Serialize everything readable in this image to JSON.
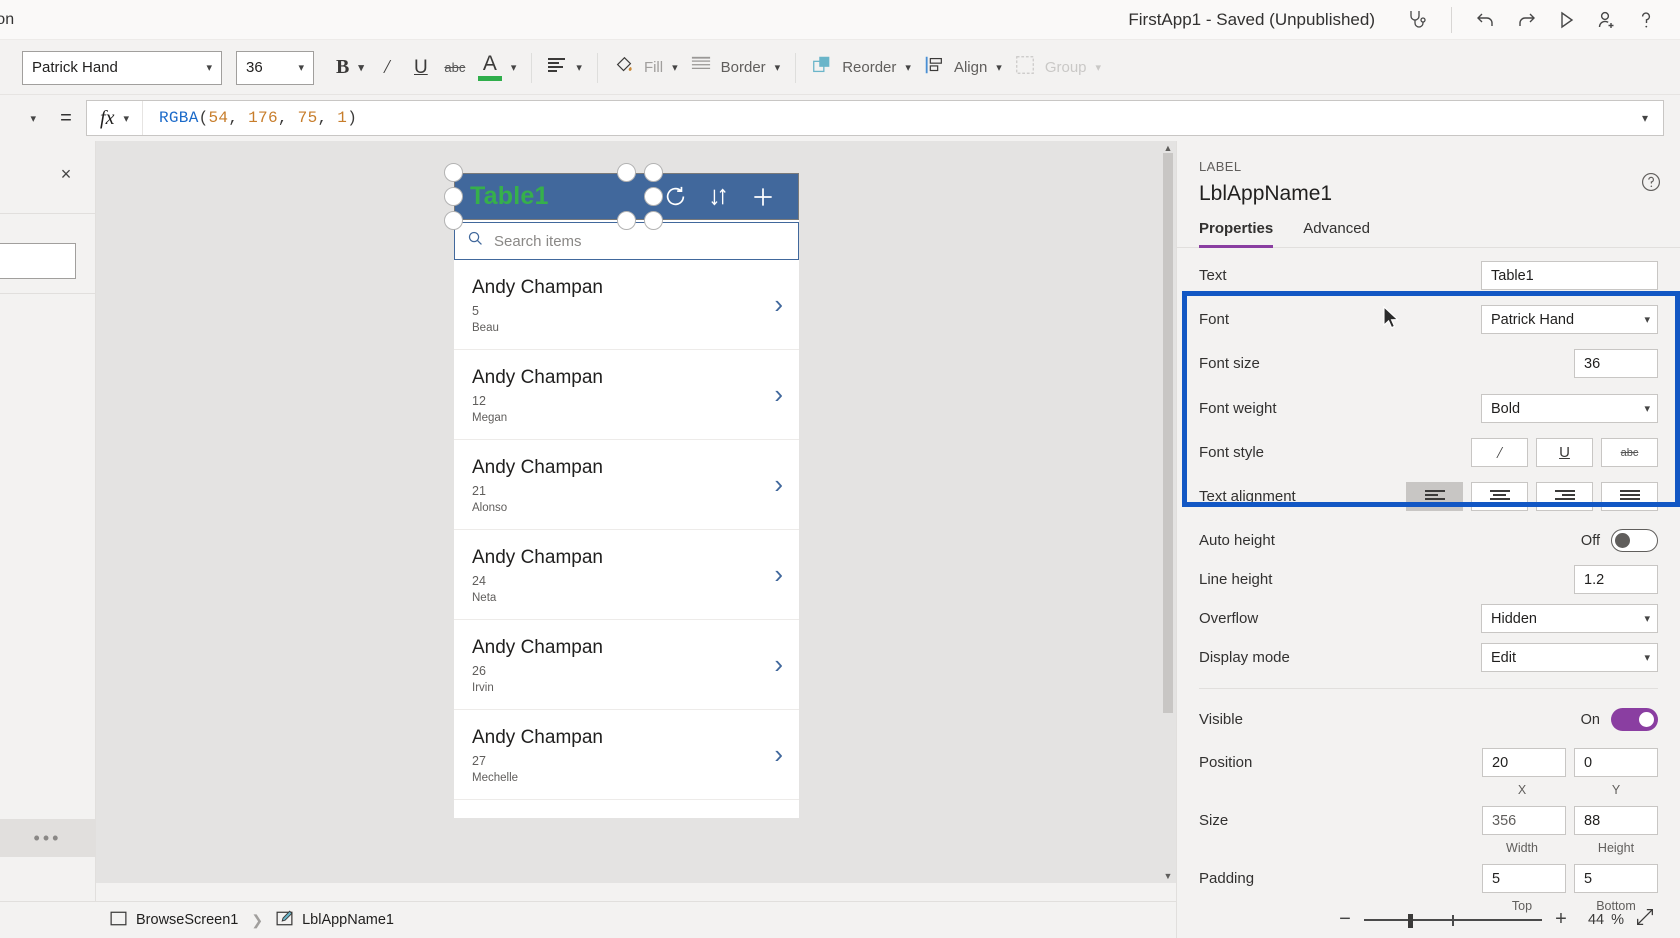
{
  "topbar": {
    "left_text": "tion",
    "app_title": "FirstApp1 - Saved (Unpublished)",
    "icons": [
      {
        "name": "app-checker-icon",
        "glyph": "stethoscope"
      },
      {
        "name": "undo-icon",
        "glyph": "undo"
      },
      {
        "name": "redo-icon",
        "glyph": "redo"
      },
      {
        "name": "preview-play-icon",
        "glyph": "play"
      },
      {
        "name": "share-user-icon",
        "glyph": "person-add"
      },
      {
        "name": "help-icon",
        "glyph": "question"
      }
    ]
  },
  "formatbar": {
    "font_value": "Patrick Hand",
    "font_size_value": "36",
    "bold_label": "B",
    "italic_label": "/",
    "underline_label": "U",
    "strikethrough_label": "abc",
    "font_color_label": "A",
    "font_color_swatch": "#2fae4b",
    "align_label": "",
    "fill_label": "Fill",
    "border_label": "Border",
    "reorder_label": "Reorder",
    "align_menu_label": "Align",
    "group_label": "Group"
  },
  "formulabar": {
    "equals": "=",
    "fx_label": "fx",
    "formula_fn": "RGBA",
    "formula_open": "(",
    "formula_args": [
      "54",
      "176",
      "75",
      "1"
    ],
    "formula_close": ")",
    "formula_full": "RGBA(54, 176, 75, 1)"
  },
  "leftpanel": {
    "close_label": "×",
    "overflow_label": "•••"
  },
  "canvas": {
    "gallery": {
      "title": "Table1",
      "title_color": "#36b04b",
      "header_bg": "#41689c",
      "refresh_icon": "refresh-icon",
      "sort_icon": "sort-icon",
      "add_icon": "add-icon",
      "search_placeholder": "Search items",
      "rows": [
        {
          "name": "Andy Champan",
          "sub1": "5",
          "sub2": "Beau"
        },
        {
          "name": "Andy Champan",
          "sub1": "12",
          "sub2": "Megan"
        },
        {
          "name": "Andy Champan",
          "sub1": "21",
          "sub2": "Alonso"
        },
        {
          "name": "Andy Champan",
          "sub1": "24",
          "sub2": "Neta"
        },
        {
          "name": "Andy Champan",
          "sub1": "26",
          "sub2": "Irvin"
        },
        {
          "name": "Andy Champan",
          "sub1": "27",
          "sub2": "Mechelle"
        }
      ]
    }
  },
  "properties": {
    "kind": "LABEL",
    "control_name": "LblAppName1",
    "tabs": [
      {
        "label": "Properties",
        "active": true
      },
      {
        "label": "Advanced",
        "active": false
      }
    ],
    "rows": {
      "text": {
        "label": "Text",
        "value": "Table1"
      },
      "font": {
        "label": "Font",
        "value": "Patrick Hand"
      },
      "font_size": {
        "label": "Font size",
        "value": "36"
      },
      "font_weight": {
        "label": "Font weight",
        "value": "Bold"
      },
      "font_style": {
        "label": "Font style",
        "italic": "/",
        "underline": "U",
        "strike": "abc"
      },
      "text_alignment": {
        "label": "Text alignment"
      },
      "auto_height": {
        "label": "Auto height",
        "state": "Off"
      },
      "line_height": {
        "label": "Line height",
        "value": "1.2"
      },
      "overflow": {
        "label": "Overflow",
        "value": "Hidden"
      },
      "display_mode": {
        "label": "Display mode",
        "value": "Edit"
      },
      "visible": {
        "label": "Visible",
        "state": "On"
      },
      "position": {
        "label": "Position",
        "x": "20",
        "y": "0",
        "x_label": "X",
        "y_label": "Y"
      },
      "size": {
        "label": "Size",
        "width": "356",
        "height": "88",
        "width_label": "Width",
        "height_label": "Height"
      },
      "padding": {
        "label": "Padding",
        "top": "5",
        "bottom": "5",
        "top_label": "Top",
        "bottom_label": "Bottom"
      }
    },
    "highlight_color": "#1257c4",
    "accent_color": "#8a3ea1"
  },
  "bottombar": {
    "breadcrumb": [
      {
        "label": "BrowseScreen1",
        "icon": "screen-icon"
      },
      {
        "label": "LblAppName1",
        "icon": "label-edit-icon"
      }
    ],
    "zoom_out": "−",
    "zoom_in": "+",
    "zoom_value": "44",
    "zoom_unit": "%",
    "fit_label": "fit-screen-icon"
  }
}
